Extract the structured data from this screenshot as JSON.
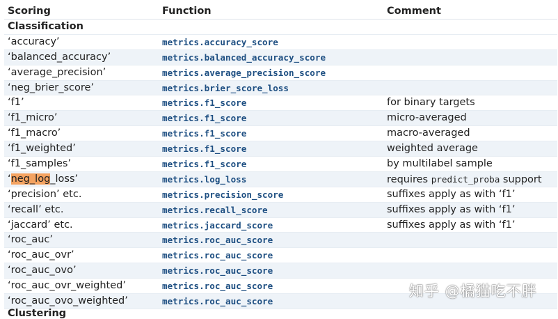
{
  "header": {
    "scoring": "Scoring",
    "function": "Function",
    "comment": "Comment"
  },
  "group_classification": "Classification",
  "rows": [
    {
      "scoring": "‘accuracy’",
      "function": "metrics.accuracy_score",
      "comment": ""
    },
    {
      "scoring": "‘balanced_accuracy’",
      "function": "metrics.balanced_accuracy_score",
      "comment": ""
    },
    {
      "scoring": "‘average_precision’",
      "function": "metrics.average_precision_score",
      "comment": ""
    },
    {
      "scoring": "‘neg_brier_score’",
      "function": "metrics.brier_score_loss",
      "comment": ""
    },
    {
      "scoring": "‘f1’",
      "function": "metrics.f1_score",
      "comment": "for binary targets"
    },
    {
      "scoring": "‘f1_micro’",
      "function": "metrics.f1_score",
      "comment": "micro-averaged"
    },
    {
      "scoring": "‘f1_macro’",
      "function": "metrics.f1_score",
      "comment": "macro-averaged"
    },
    {
      "scoring": "‘f1_weighted’",
      "function": "metrics.f1_score",
      "comment": "weighted average"
    },
    {
      "scoring": "‘f1_samples’",
      "function": "metrics.f1_score",
      "comment": "by multilabel sample"
    },
    {
      "scoring_hl": "neg_log",
      "scoring_pre": "‘",
      "scoring_post": "_loss’",
      "function": "metrics.log_loss",
      "comment_pre": "requires ",
      "comment_code": "predict_proba",
      "comment_post": " support"
    },
    {
      "scoring": "‘precision’ etc.",
      "function": "metrics.precision_score",
      "comment": "suffixes apply as with ‘f1’"
    },
    {
      "scoring": "‘recall’ etc.",
      "function": "metrics.recall_score",
      "comment": "suffixes apply as with ‘f1’"
    },
    {
      "scoring": "‘jaccard’ etc.",
      "function": "metrics.jaccard_score",
      "comment": "suffixes apply as with ‘f1’"
    },
    {
      "scoring": "‘roc_auc’",
      "function": "metrics.roc_auc_score",
      "comment": ""
    },
    {
      "scoring": "‘roc_auc_ovr’",
      "function": "metrics.roc_auc_score",
      "comment": ""
    },
    {
      "scoring": "‘roc_auc_ovo’",
      "function": "metrics.roc_auc_score",
      "comment": ""
    },
    {
      "scoring": "‘roc_auc_ovr_weighted’",
      "function": "metrics.roc_auc_score",
      "comment": ""
    },
    {
      "scoring": "‘roc_auc_ovo_weighted’",
      "function": "metrics.roc_auc_score",
      "comment": ""
    }
  ],
  "cut_off_group": "Clustering",
  "watermark": "知乎 @橘猫吃不胖",
  "colors": {
    "alt_row": "#eef3f8",
    "function_text": "#1e4f82",
    "highlight": "#f4a361"
  }
}
